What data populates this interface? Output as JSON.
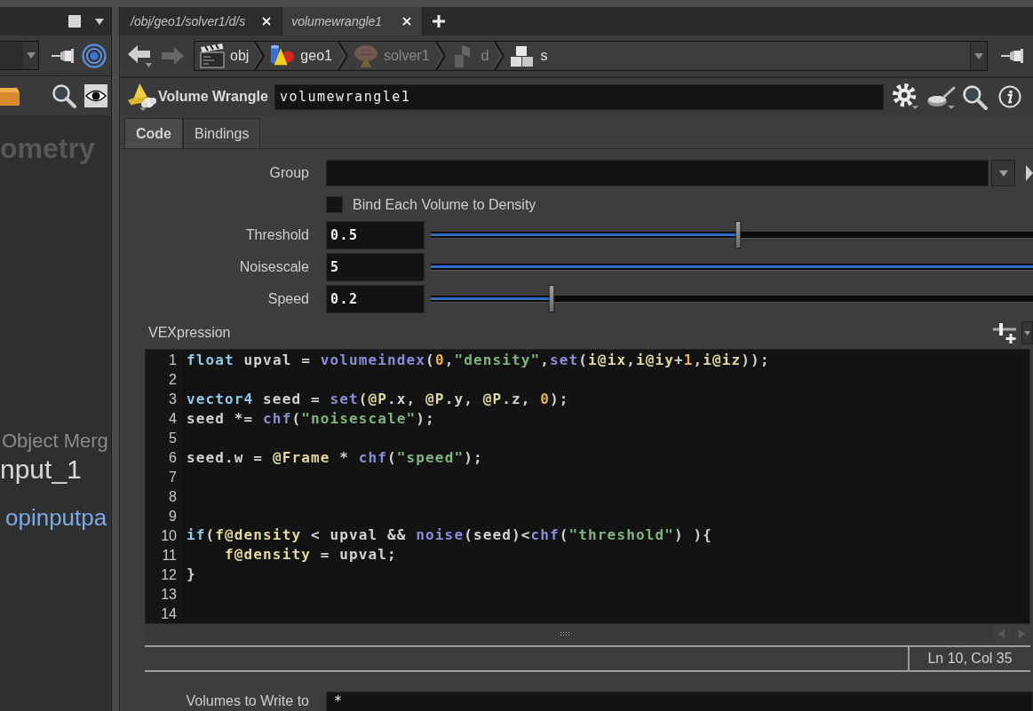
{
  "left_pane": {
    "network_title": "ometry",
    "node_type": "Object Merg",
    "node_name": "nput_1",
    "parameter_link": "opinputpa"
  },
  "pane_tabs": [
    {
      "label": "/obj/geo1/solver1/d/s",
      "selected": false
    },
    {
      "label": "volumewrangle1",
      "selected": true
    }
  ],
  "path_bar": [
    {
      "label": "obj",
      "kind": "objects",
      "dimmed": false
    },
    {
      "label": "geo1",
      "kind": "geometry",
      "dimmed": false
    },
    {
      "label": "solver1",
      "kind": "solver",
      "dimmed": true
    },
    {
      "label": "d",
      "kind": "dynamics",
      "dimmed": true
    },
    {
      "label": "s",
      "kind": "node",
      "dimmed": false
    }
  ],
  "node_header": {
    "type": "Volume Wrangle",
    "name": "volumewrangle1"
  },
  "parameter_tabs": [
    {
      "label": "Code",
      "selected": true
    },
    {
      "label": "Bindings",
      "selected": false
    }
  ],
  "parameters": [
    {
      "kind": "menu_field",
      "label": "Group"
    },
    {
      "kind": "checkbox",
      "label": "Bind Each Volume to Density",
      "checked": false
    },
    {
      "kind": "slider",
      "label": "Threshold",
      "value": "0.5",
      "level": 0.51
    },
    {
      "kind": "slider",
      "label": "Noisescale",
      "value": "5",
      "level": 1
    },
    {
      "kind": "slider",
      "label": "Speed",
      "value": "0.2",
      "level": 0.2
    }
  ],
  "vexpression": {
    "label": "VEXpression",
    "lines": [
      {
        "number": "1",
        "tokens": [
          {
            "text": "float",
            "kind": "keyword"
          },
          {
            "text": " upval = ",
            "kind": "plain"
          },
          {
            "text": "volumeindex",
            "kind": "function"
          },
          {
            "text": "(",
            "kind": "plain"
          },
          {
            "text": "0",
            "kind": "number"
          },
          {
            "text": ",",
            "kind": "plain"
          },
          {
            "text": "\"density\"",
            "kind": "string"
          },
          {
            "text": ",",
            "kind": "plain"
          },
          {
            "text": "set",
            "kind": "function"
          },
          {
            "text": "(",
            "kind": "plain"
          },
          {
            "text": "i@ix",
            "kind": "attribute"
          },
          {
            "text": ",",
            "kind": "plain"
          },
          {
            "text": "i@iy",
            "kind": "attribute"
          },
          {
            "text": "+",
            "kind": "plain"
          },
          {
            "text": "1",
            "kind": "number"
          },
          {
            "text": ",",
            "kind": "plain"
          },
          {
            "text": "i@iz",
            "kind": "attribute"
          },
          {
            "text": "));",
            "kind": "plain"
          }
        ]
      },
      {
        "number": "2"
      },
      {
        "number": "3",
        "tokens": [
          {
            "text": "vector4",
            "kind": "keyword"
          },
          {
            "text": " seed = ",
            "kind": "plain"
          },
          {
            "text": "set",
            "kind": "function"
          },
          {
            "text": "(",
            "kind": "plain"
          },
          {
            "text": "@P",
            "kind": "attribute"
          },
          {
            "text": ".x, ",
            "kind": "plain"
          },
          {
            "text": "@P",
            "kind": "attribute"
          },
          {
            "text": ".y, ",
            "kind": "plain"
          },
          {
            "text": "@P",
            "kind": "attribute"
          },
          {
            "text": ".z, ",
            "kind": "plain"
          },
          {
            "text": "0",
            "kind": "number"
          },
          {
            "text": ");",
            "kind": "plain"
          }
        ]
      },
      {
        "number": "4",
        "tokens": [
          {
            "text": "seed *= ",
            "kind": "plain"
          },
          {
            "text": "chf",
            "kind": "function"
          },
          {
            "text": "(",
            "kind": "plain"
          },
          {
            "text": "\"noisescale\"",
            "kind": "string"
          },
          {
            "text": ");",
            "kind": "plain"
          }
        ]
      },
      {
        "number": "5"
      },
      {
        "number": "6",
        "tokens": [
          {
            "text": "seed.w = ",
            "kind": "plain"
          },
          {
            "text": "@Frame",
            "kind": "attribute"
          },
          {
            "text": " * ",
            "kind": "plain"
          },
          {
            "text": "chf",
            "kind": "function"
          },
          {
            "text": "(",
            "kind": "plain"
          },
          {
            "text": "\"speed\"",
            "kind": "string"
          },
          {
            "text": ");",
            "kind": "plain"
          }
        ]
      },
      {
        "number": "7"
      },
      {
        "number": "8"
      },
      {
        "number": "9"
      },
      {
        "number": "10",
        "tokens": [
          {
            "text": "if",
            "kind": "keyword"
          },
          {
            "text": "(",
            "kind": "plain"
          },
          {
            "text": "f@density",
            "kind": "attribute"
          },
          {
            "text": " < upval && ",
            "kind": "plain"
          },
          {
            "text": "noise",
            "kind": "function"
          },
          {
            "text": "(seed)<",
            "kind": "plain"
          },
          {
            "text": "chf",
            "kind": "function"
          },
          {
            "text": "(",
            "kind": "plain"
          },
          {
            "text": "\"threshold\"",
            "kind": "string"
          },
          {
            "text": ") ){",
            "kind": "plain"
          }
        ]
      },
      {
        "number": "11",
        "tokens": [
          {
            "text": "    f@density",
            "kind": "attribute"
          },
          {
            "text": " = upval;",
            "kind": "plain"
          }
        ]
      },
      {
        "number": "12",
        "tokens": [
          {
            "text": "}",
            "kind": "plain"
          }
        ]
      },
      {
        "number": "13"
      },
      {
        "number": "14"
      }
    ],
    "cursor_position": "Ln 10, Col 35"
  },
  "next_parameter": {
    "label": "Volumes to Write to",
    "value": "*"
  }
}
